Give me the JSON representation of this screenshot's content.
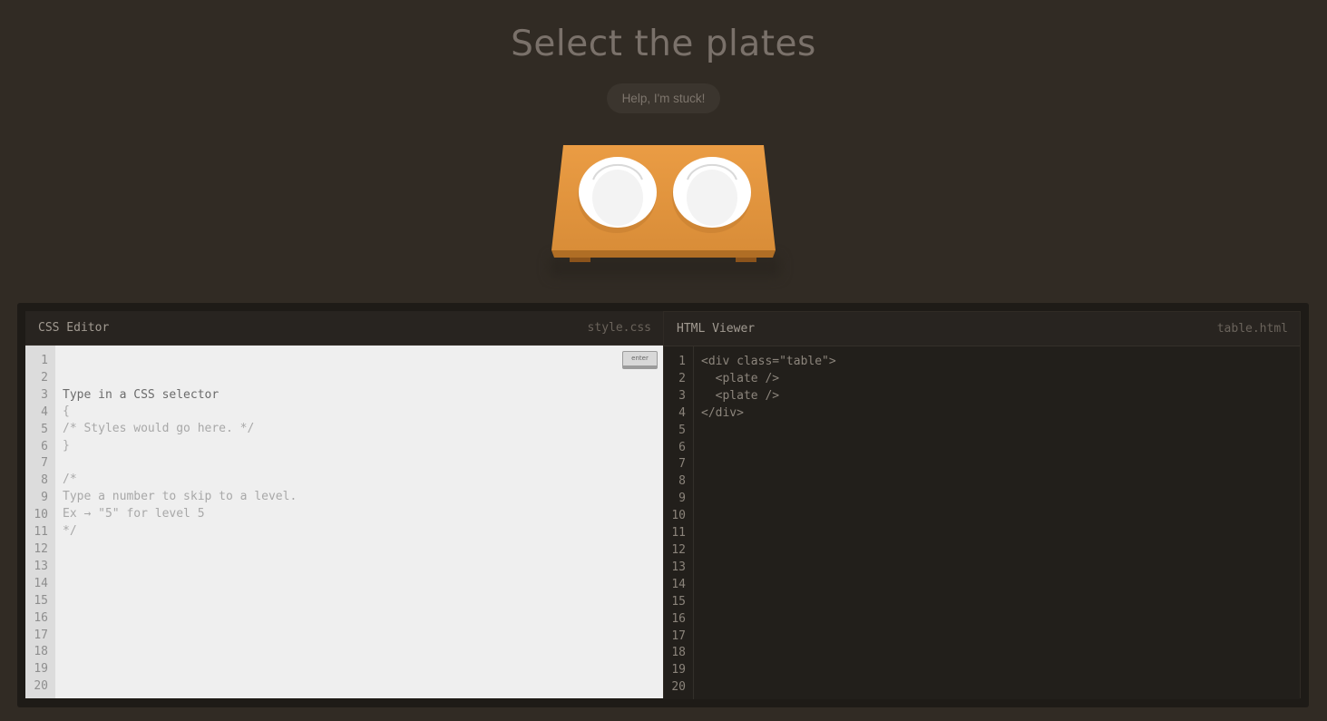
{
  "level": {
    "title": "Select the plates",
    "help_label": "Help, I'm stuck!"
  },
  "table_scene": {
    "items": [
      "plate",
      "plate"
    ],
    "colors": {
      "table": "#e59a3f",
      "plate": "#ffffff"
    }
  },
  "css_editor": {
    "title": "CSS Editor",
    "file": "style.css",
    "placeholder": "Type in a CSS selector",
    "enter_label": "enter",
    "lines": [
      "{",
      "/* Styles would go here. */",
      "}",
      "",
      "/*",
      "Type a number to skip to a level.",
      "Ex → \"5\" for level 5",
      "*/"
    ],
    "line_numbers": [
      "1",
      "2",
      "3",
      "4",
      "5",
      "6",
      "7",
      "8",
      "9",
      "10",
      "11",
      "12",
      "13",
      "14",
      "15",
      "16",
      "17",
      "18",
      "19",
      "20"
    ]
  },
  "html_viewer": {
    "title": "HTML Viewer",
    "file": "table.html",
    "lines": [
      "<div class=\"table\">",
      "  <plate />",
      "  <plate />",
      "</div>"
    ],
    "line_numbers": [
      "1",
      "2",
      "3",
      "4",
      "5",
      "6",
      "7",
      "8",
      "9",
      "10",
      "11",
      "12",
      "13",
      "14",
      "15",
      "16",
      "17",
      "18",
      "19",
      "20"
    ]
  }
}
